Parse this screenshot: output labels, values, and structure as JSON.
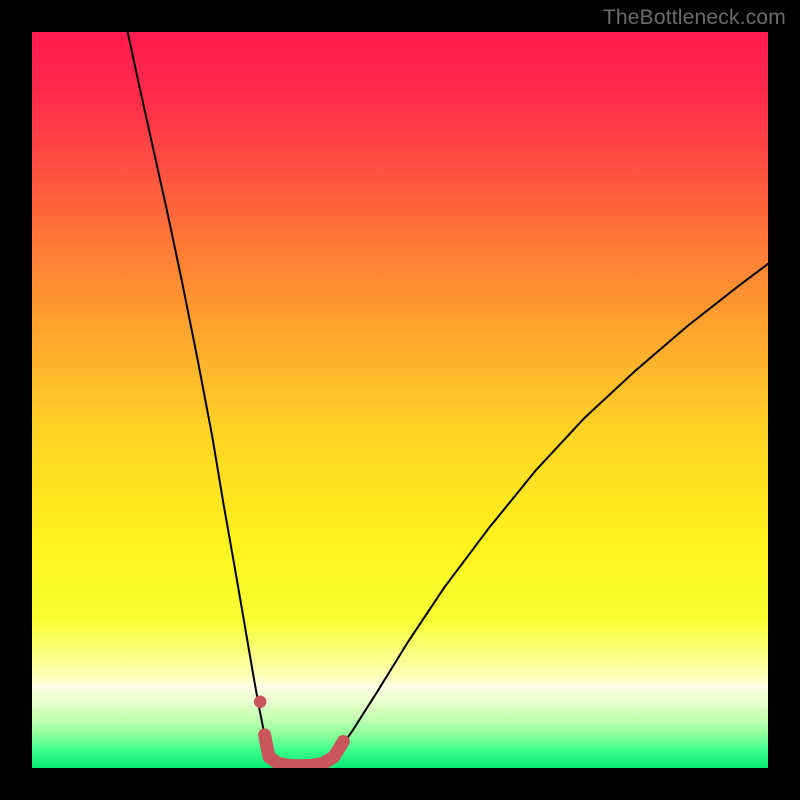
{
  "watermark": "TheBottleneck.com",
  "colors": {
    "frame": "#000000",
    "watermark": "#6a6a6a",
    "curve": "#000000",
    "highlight": "#c9565d",
    "gradient_stops": [
      {
        "offset": 0.0,
        "color": "#ff1a4f"
      },
      {
        "offset": 0.1,
        "color": "#ff2f4a"
      },
      {
        "offset": 0.25,
        "color": "#ff6a3a"
      },
      {
        "offset": 0.4,
        "color": "#ffa32f"
      },
      {
        "offset": 0.55,
        "color": "#ffd524"
      },
      {
        "offset": 0.7,
        "color": "#fff41e"
      },
      {
        "offset": 0.8,
        "color": "#f6ff33"
      },
      {
        "offset": 0.87,
        "color": "#ffffb0"
      },
      {
        "offset": 0.89,
        "color": "#ffffe6"
      },
      {
        "offset": 0.91,
        "color": "#e9ffcf"
      },
      {
        "offset": 0.93,
        "color": "#c7ffb4"
      },
      {
        "offset": 0.955,
        "color": "#8dff9d"
      },
      {
        "offset": 0.975,
        "color": "#3fff8e"
      },
      {
        "offset": 1.0,
        "color": "#07e873"
      }
    ]
  },
  "chart_data": {
    "type": "line",
    "title": "",
    "xlabel": "",
    "ylabel": "",
    "xlim": [
      0,
      100
    ],
    "ylim": [
      0,
      100
    ],
    "grid": false,
    "legend": false,
    "series": [
      {
        "name": "left-branch",
        "x": [
          13.0,
          14.5,
          16.5,
          18.5,
          20.5,
          22.5,
          24.5,
          26.0,
          27.5,
          28.8,
          30.0,
          30.8,
          31.6,
          32.2
        ],
        "y": [
          100.0,
          93.0,
          84.0,
          75.0,
          65.5,
          55.5,
          45.0,
          36.0,
          27.5,
          20.0,
          13.0,
          8.5,
          4.5,
          1.5
        ]
      },
      {
        "name": "valley-floor",
        "x": [
          32.2,
          33.5,
          35.0,
          36.5,
          38.0,
          39.5,
          41.0
        ],
        "y": [
          1.5,
          0.6,
          0.35,
          0.3,
          0.35,
          0.6,
          1.5
        ]
      },
      {
        "name": "right-branch",
        "x": [
          41.0,
          43.5,
          47.0,
          51.0,
          56.0,
          62.0,
          68.5,
          75.0,
          82.0,
          89.0,
          96.0,
          100.0
        ],
        "y": [
          1.5,
          5.0,
          10.5,
          17.0,
          24.5,
          32.5,
          40.5,
          47.5,
          54.0,
          60.0,
          65.5,
          68.5
        ]
      },
      {
        "name": "highlight-floor",
        "x": [
          31.6,
          32.2,
          33.5,
          35.0,
          36.5,
          38.0,
          39.5,
          41.0,
          42.3
        ],
        "y": [
          4.5,
          1.5,
          0.6,
          0.35,
          0.3,
          0.35,
          0.6,
          1.5,
          3.6
        ]
      },
      {
        "name": "highlight-dot",
        "x": [
          31.0
        ],
        "y": [
          9.0
        ]
      }
    ],
    "annotations": []
  }
}
